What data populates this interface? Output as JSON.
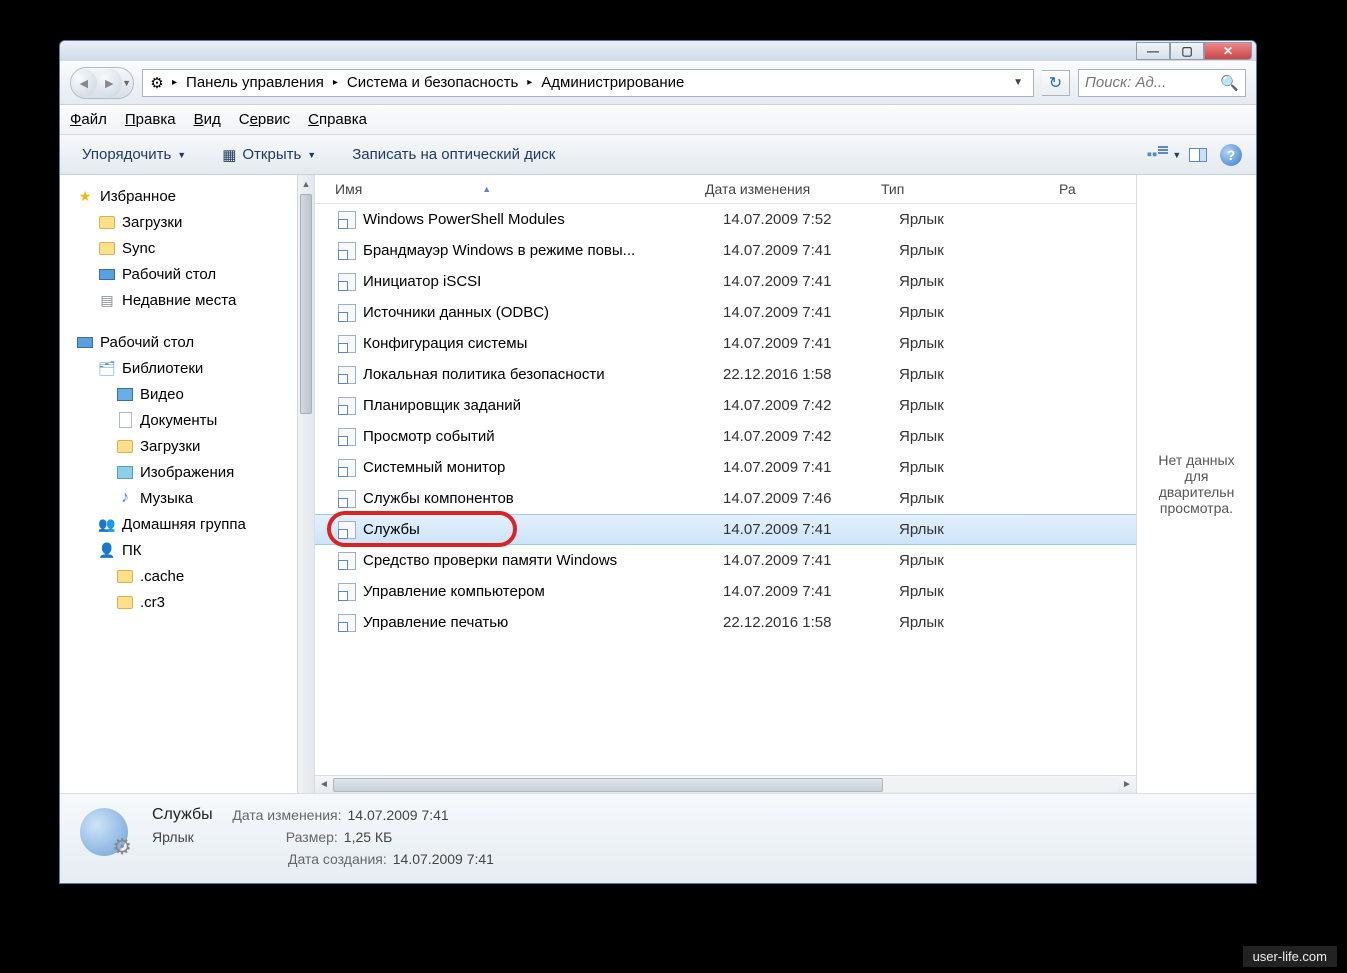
{
  "titlebar": {
    "min": "—",
    "max": "▢",
    "close": "✕"
  },
  "nav": {
    "segments": [
      "Панель управления",
      "Система и безопасность",
      "Администрирование"
    ],
    "search_placeholder": "Поиск: Ад..."
  },
  "menubar": {
    "file": "Файл",
    "edit": "Правка",
    "view": "Вид",
    "service": "Сервис",
    "help": "Справка"
  },
  "toolbar": {
    "organize": "Упорядочить",
    "open": "Открыть",
    "burn": "Записать на оптический диск"
  },
  "columns": {
    "name": "Имя",
    "date": "Дата изменения",
    "type": "Тип",
    "size": "Ра"
  },
  "sidebar": {
    "fav": "Избранное",
    "downloads": "Загрузки",
    "sync": "Sync",
    "desktop": "Рабочий стол",
    "recent": "Недавние места",
    "desktop2": "Рабочий стол",
    "libs": "Библиотеки",
    "video": "Видео",
    "docs": "Документы",
    "downloads2": "Загрузки",
    "pics": "Изображения",
    "music": "Музыка",
    "homegroup": "Домашняя группа",
    "pc": "ПК",
    "cache": ".cache",
    "cr3": ".cr3"
  },
  "files": [
    {
      "name": "Windows PowerShell Modules",
      "date": "14.07.2009 7:52",
      "type": "Ярлык",
      "sel": false
    },
    {
      "name": "Брандмауэр Windows в режиме повы...",
      "date": "14.07.2009 7:41",
      "type": "Ярлык",
      "sel": false
    },
    {
      "name": "Инициатор iSCSI",
      "date": "14.07.2009 7:41",
      "type": "Ярлык",
      "sel": false
    },
    {
      "name": "Источники данных (ODBC)",
      "date": "14.07.2009 7:41",
      "type": "Ярлык",
      "sel": false
    },
    {
      "name": "Конфигурация системы",
      "date": "14.07.2009 7:41",
      "type": "Ярлык",
      "sel": false
    },
    {
      "name": "Локальная политика безопасности",
      "date": "22.12.2016 1:58",
      "type": "Ярлык",
      "sel": false
    },
    {
      "name": "Планировщик заданий",
      "date": "14.07.2009 7:42",
      "type": "Ярлык",
      "sel": false
    },
    {
      "name": "Просмотр событий",
      "date": "14.07.2009 7:42",
      "type": "Ярлык",
      "sel": false
    },
    {
      "name": "Системный монитор",
      "date": "14.07.2009 7:41",
      "type": "Ярлык",
      "sel": false
    },
    {
      "name": "Службы компонентов",
      "date": "14.07.2009 7:46",
      "type": "Ярлык",
      "sel": false
    },
    {
      "name": "Службы",
      "date": "14.07.2009 7:41",
      "type": "Ярлык",
      "sel": true
    },
    {
      "name": "Средство проверки памяти Windows",
      "date": "14.07.2009 7:41",
      "type": "Ярлык",
      "sel": false
    },
    {
      "name": "Управление компьютером",
      "date": "14.07.2009 7:41",
      "type": "Ярлык",
      "sel": false
    },
    {
      "name": "Управление печатью",
      "date": "22.12.2016 1:58",
      "type": "Ярлык",
      "sel": false
    }
  ],
  "preview": "Нет данных для дварительн просмотра.",
  "details": {
    "name": "Службы",
    "type": "Ярлык",
    "mod_label": "Дата изменения:",
    "mod_val": "14.07.2009 7:41",
    "size_label": "Размер:",
    "size_val": "1,25 КБ",
    "created_label": "Дата создания:",
    "created_val": "14.07.2009 7:41"
  },
  "watermark": "user-life.com"
}
